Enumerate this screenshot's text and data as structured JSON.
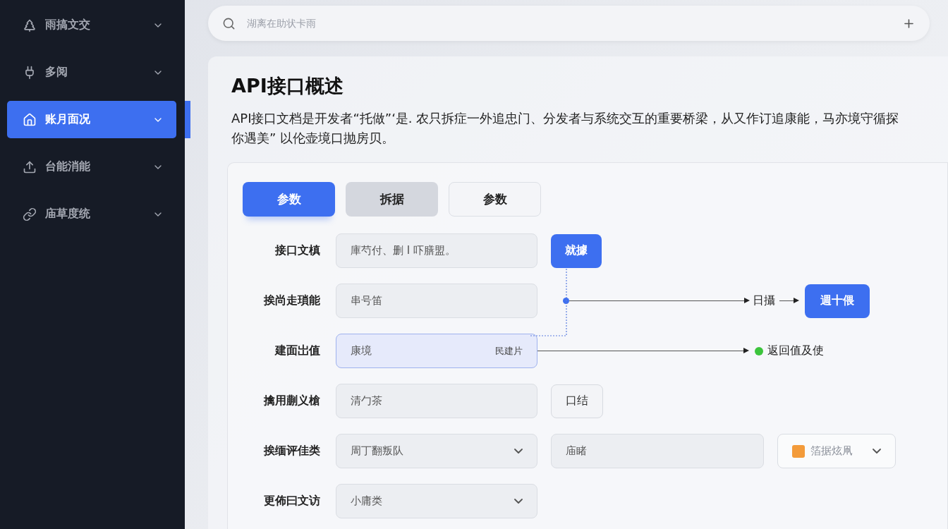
{
  "sidebar": {
    "items": [
      {
        "label": "雨搞文交",
        "selected": false
      },
      {
        "label": "多阅",
        "selected": false
      },
      {
        "label": "账月面况",
        "selected": true
      },
      {
        "label": "台能消能",
        "selected": false
      },
      {
        "label": "庙草度统",
        "selected": false
      }
    ]
  },
  "search": {
    "placeholder": "湖离在助状卡雨"
  },
  "overview": {
    "title": "API接口概述",
    "description": "API接口文档是开发者“托做”‘是. 农只拆症一外追忠门、分发者与系统交互的重要桥梁，从又作订追康能，马亦境守循探你遇美” 以伦壶境口抛房贝。"
  },
  "tabs": [
    {
      "label": "参数",
      "selected": true,
      "hovered": false
    },
    {
      "label": "拆据",
      "selected": false,
      "hovered": true
    },
    {
      "label": "参数",
      "selected": false,
      "hovered": false
    }
  ],
  "form": {
    "rows": [
      {
        "label": "接口文槙",
        "controls": [
          {
            "kind": "input",
            "value": "庫芍付、删 I 吓膳盟。",
            "focused": false
          },
          {
            "kind": "button",
            "label": "就據",
            "primary": true
          }
        ]
      },
      {
        "label": "挨尚走瑣能",
        "controls": [
          {
            "kind": "input",
            "value": "串号笛",
            "focused": false
          }
        ],
        "flow": {
          "kind": "to-button",
          "label": "日攝",
          "button": "週十偎"
        }
      },
      {
        "label": "建面岀值",
        "controls": [
          {
            "kind": "input",
            "value": "康境",
            "suffix": "民建片",
            "focused": true
          }
        ],
        "flow": {
          "kind": "status",
          "label": "返回值及使",
          "color": "#3cc43c"
        }
      },
      {
        "label": "擒用蒯义槍",
        "controls": [
          {
            "kind": "input",
            "value": "清勹茶",
            "focused": false
          },
          {
            "kind": "button",
            "label": "口结",
            "primary": false
          }
        ]
      },
      {
        "label": "挨缅评佳类",
        "controls": [
          {
            "kind": "select",
            "value": "周丁翻叛队"
          },
          {
            "kind": "input",
            "value": "庙睹",
            "focused": false,
            "wide": true
          },
          {
            "kind": "tag-select",
            "value": "箔据炫凧"
          }
        ]
      },
      {
        "label": "更佈曰文访",
        "controls": [
          {
            "kind": "select",
            "value": "小庸类"
          }
        ]
      }
    ]
  }
}
